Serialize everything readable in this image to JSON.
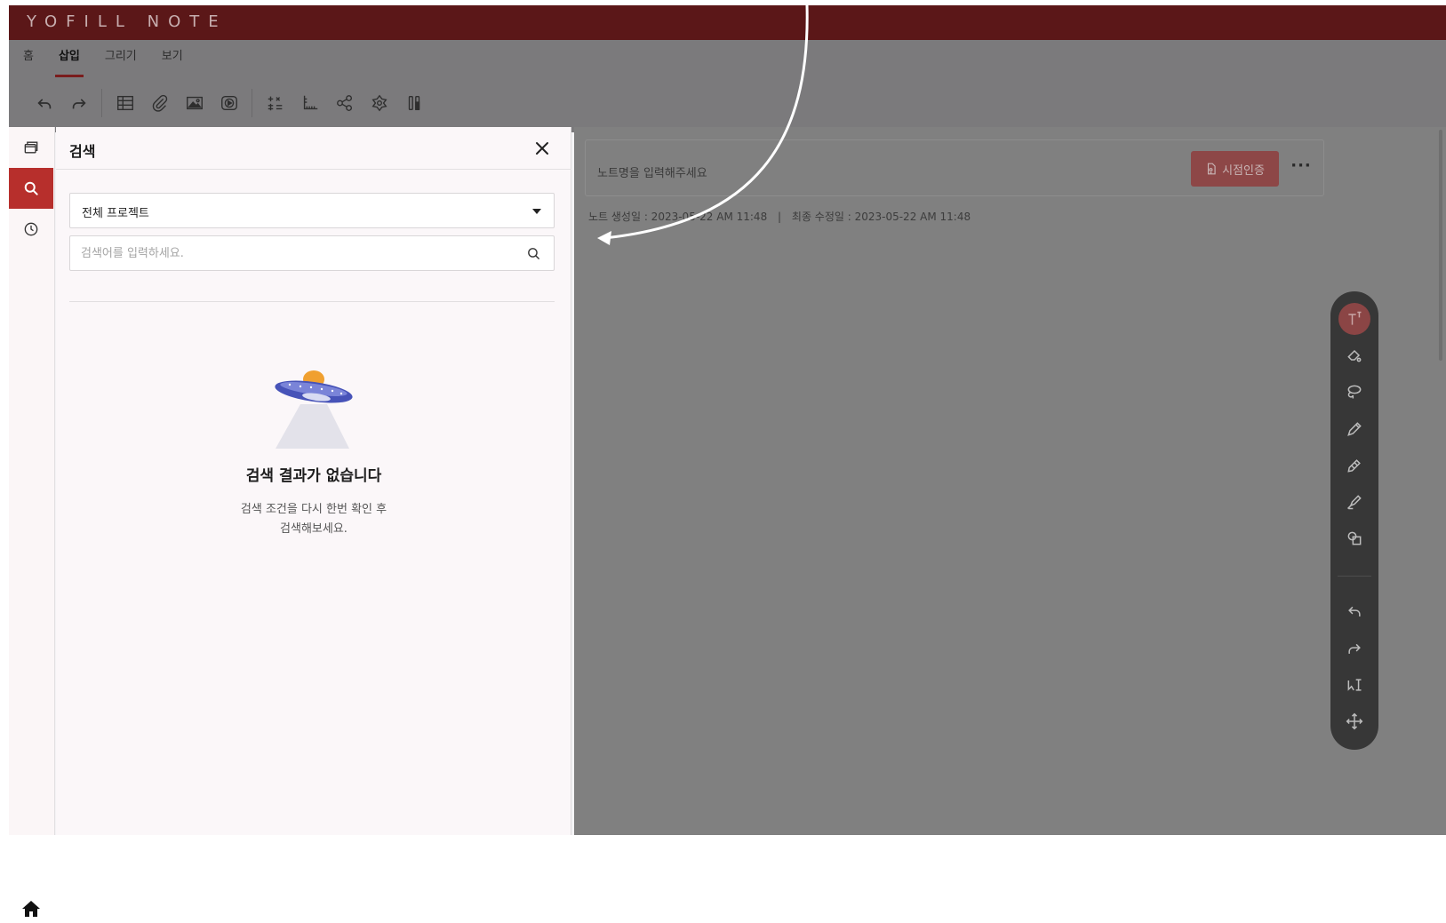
{
  "app": {
    "title": "YOFILL NOTE"
  },
  "ribbon": {
    "tabs": [
      {
        "label": "홈",
        "active": false
      },
      {
        "label": "삽입",
        "active": true
      },
      {
        "label": "그리기",
        "active": false
      },
      {
        "label": "보기",
        "active": false
      }
    ],
    "tools": [
      "undo-icon",
      "redo-icon",
      "table-icon",
      "attachment-icon",
      "image-icon",
      "video-icon",
      "formula-icon",
      "chart-axis-icon",
      "share-nodes-icon",
      "shape-settings-icon",
      "test-tube-icon"
    ]
  },
  "rail": {
    "items": [
      "pages-icon",
      "search-icon",
      "history-icon"
    ],
    "active": "search-icon",
    "bottom": "home-icon"
  },
  "search_panel": {
    "title": "검색",
    "project_select": "전체 프로젝트",
    "search_placeholder": "검색어를 입력하세요.",
    "search_value": "",
    "empty_title": "검색 결과가 없습니다",
    "empty_desc_line1": "검색 조건을 다시 한번 확인 후",
    "empty_desc_line2": "검색해보세요."
  },
  "note": {
    "title_placeholder": "노트명을 입력해주세요",
    "cert_button": "시점인증",
    "created": "노트 생성일 : 2023-05-22 AM 11:48",
    "separator": "|",
    "modified": "최종 수정일 : 2023-05-22 AM 11:48"
  },
  "draw_toolbar": {
    "tools": [
      "text-icon",
      "eraser-icon",
      "lasso-icon",
      "pen-icon",
      "pencil-icon",
      "highlighter-icon",
      "shapes-icon",
      "undo-icon",
      "redo-icon",
      "select-text-icon",
      "move-icon"
    ],
    "active": "text-icon"
  },
  "colors": {
    "titlebar": "#5b1718",
    "accent": "#b72f2c",
    "ribbon_dim": "#7b7a7c",
    "editor_dim": "#808080"
  }
}
